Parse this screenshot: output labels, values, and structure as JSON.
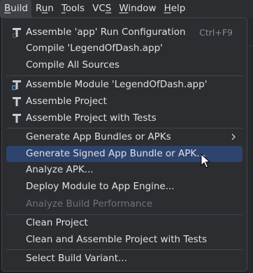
{
  "menubar": {
    "items": [
      {
        "label": "Build",
        "mnemonic": "B"
      },
      {
        "label": "Run",
        "mnemonic": "u"
      },
      {
        "label": "Tools",
        "mnemonic": "T"
      },
      {
        "label": "VCS",
        "mnemonic": "S"
      },
      {
        "label": "Window",
        "mnemonic": "W"
      },
      {
        "label": "Help",
        "mnemonic": "H"
      }
    ]
  },
  "menu": {
    "items": [
      {
        "label": "Assemble 'app' Run Configuration",
        "shortcut": "Ctrl+F9",
        "icon": "assemble-run-config-icon"
      },
      {
        "label": "Compile 'LegendOfDash.app'"
      },
      {
        "label": "Compile All Sources"
      },
      {
        "label": "Assemble Module 'LegendOfDash.app'",
        "icon": "assemble-module-icon"
      },
      {
        "label": "Assemble Project",
        "icon": "hammer-icon"
      },
      {
        "label": "Assemble Project with Tests",
        "icon": "hammer-icon"
      },
      {
        "label": "Generate App Bundles or APKs",
        "submenu": true
      },
      {
        "label": "Generate Signed App Bundle or APK...",
        "selected": true
      },
      {
        "label": "Analyze APK..."
      },
      {
        "label": "Deploy Module to App Engine..."
      },
      {
        "label": "Analyze Build Performance",
        "disabled": true
      },
      {
        "label": "Clean Project"
      },
      {
        "label": "Clean and Assemble Project with Tests"
      },
      {
        "label": "Select Build Variant..."
      }
    ]
  },
  "colors": {
    "background": "#2b2d30",
    "selection": "#2e436e",
    "text": "#dfe1e5",
    "disabled_text": "#6f737a",
    "separator": "#43454a"
  }
}
